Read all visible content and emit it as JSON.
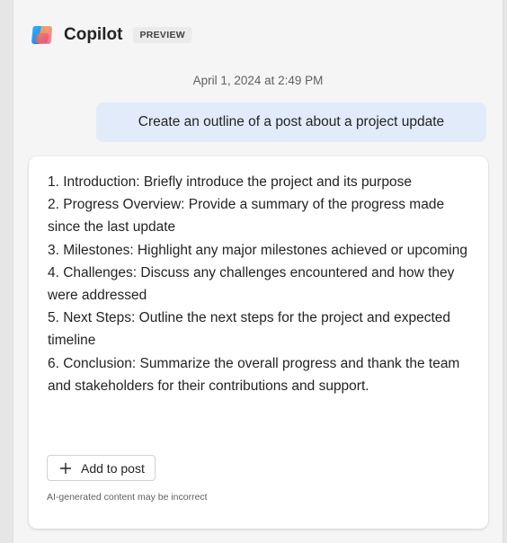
{
  "header": {
    "app_name": "Copilot",
    "badge": "PREVIEW",
    "logo_icon": "copilot-logo-icon"
  },
  "conversation": {
    "timestamp": "April 1, 2024 at 2:49 PM",
    "user_message": "Create an outline of a post about a project update",
    "response": {
      "items": [
        "1. Introduction: Briefly introduce the project and its purpose",
        "2. Progress Overview: Provide a summary of the progress made since the last update",
        "3. Milestones: Highlight any major milestones achieved or upcoming",
        "4. Challenges: Discuss any challenges encountered and how they were addressed",
        "5. Next Steps: Outline the next steps for the project and expected timeline",
        "6. Conclusion: Summarize the overall progress and thank the team and stakeholders for their contributions and support."
      ],
      "add_button_label": "Add to post",
      "add_button_icon": "plus-icon",
      "disclaimer": "AI-generated content may be incorrect"
    }
  },
  "colors": {
    "user_bubble": "#e1ebfa",
    "panel_background": "#f5f5f5",
    "card_background": "#ffffff"
  }
}
